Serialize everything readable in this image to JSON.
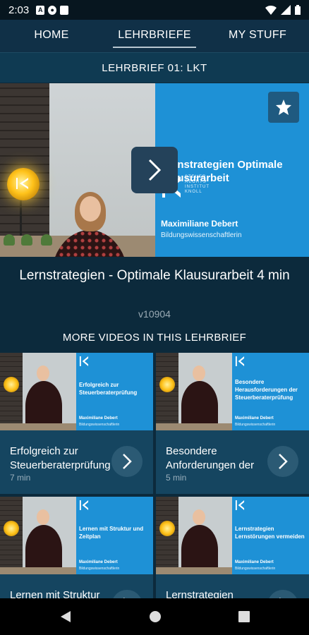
{
  "status_bar": {
    "time": "2:03"
  },
  "tabs": [
    {
      "label": "HOME",
      "active": false
    },
    {
      "label": "LEHRBRIEFE",
      "active": true
    },
    {
      "label": "MY STUFF",
      "active": false
    }
  ],
  "section": {
    "title": "LEHRBRIEF 01: LKT"
  },
  "hero": {
    "logo_text": [
      "STEUER",
      "RECHTS",
      "INSTITUT",
      "KNOLL"
    ],
    "slide_title": "Lernstrategien Optimale Klausurarbeit",
    "presenter_name": "Maximiliane Debert",
    "presenter_role": "Bildungswissenschaftlerin"
  },
  "video": {
    "title": "Lernstrategien - Optimale Klausurarbeit 4 min",
    "id": "v10904"
  },
  "more_heading": "MORE VIDEOS IN THIS LEHRBRIEF",
  "cards": [
    {
      "thumb_title": "Erfolgreich zur Steuerberaterprüfung",
      "title": "Erfolgreich zur Steuerberaterprüfung",
      "duration": "7 min",
      "presenter_name": "Maximiliane Debert",
      "presenter_role": "Bildungswissenschaftlerin"
    },
    {
      "thumb_title": "Besondere Herausforderungen der Steuerberaterprüfung",
      "title": "Besondere Anforderungen der",
      "duration": "5 min",
      "presenter_name": "Maximiliane Debert",
      "presenter_role": "Bildungswissenschaftlerin"
    },
    {
      "thumb_title": "Lernen mit Struktur und Zeitplan",
      "title": "Lernen mit Struktur",
      "duration": "",
      "presenter_name": "Maximiliane Debert",
      "presenter_role": "Bildungswissenschaftlerin"
    },
    {
      "thumb_title": "Lernstrategien Lernstörungen vermeiden",
      "title": "Lernstrategien",
      "duration": "",
      "presenter_name": "Maximiliane Debert",
      "presenter_role": "Bildungswissenschaftlerin"
    }
  ],
  "colors": {
    "background": "#0c2a3c",
    "accent_blue": "#1e91d6",
    "card": "#154560"
  }
}
